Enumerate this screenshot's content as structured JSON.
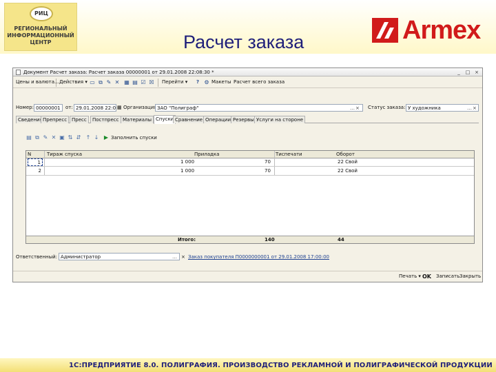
{
  "slide": {
    "title": "Расчет заказа",
    "logo_emblem": "РИЦ",
    "logo_text": "РЕГИОНАЛЬНЫЙ\nИНФОРМАЦИОННЫЙ\nЦЕНТР",
    "brand": "Armex",
    "footer": "1С:ПРЕДПРИЯТИЕ 8.0. ПОЛИГРАФИЯ. ПРОИЗВОДСТВО РЕКЛАМНОЙ И ПОЛИГРАФИЧЕСКОЙ ПРОДУКЦИИ",
    "colors": {
      "title": "#1f1f7a",
      "brand": "#d11b1b",
      "band": "#f3df75"
    }
  },
  "window": {
    "title": "Документ Расчет заказа: Расчет заказа 00000001 от 29.01.2008 22:08:30 *",
    "controls": [
      "_",
      "□",
      "×"
    ]
  },
  "toolbar": {
    "prices": "Цены и валюта...",
    "actions": "Действия ▾",
    "goto": "Перейти ▾",
    "help": "?",
    "layouts": "Макеты",
    "calc_all": "Расчет всего заказа"
  },
  "header": {
    "number_label": "Номер:",
    "number_value": "00000001",
    "date_label": "от:",
    "date_value": "29.01.2008 22:08:30",
    "org_label": "Организация:",
    "org_value": "ЗАО \"Полиграф\"",
    "status_label": "Статус заказа:",
    "status_value": "У художника"
  },
  "tabs": [
    "Сведения",
    "Препресс",
    "Пресс",
    "Постпресс",
    "Материалы",
    "Спуски",
    "Сравнение",
    "Операции",
    "Резервы",
    "Услуги на стороне"
  ],
  "active_tab": "Спуски",
  "grid_toolbar": {
    "fill_label": "Заполнить спуски"
  },
  "grid": {
    "columns": [
      "N",
      "Тираж спуска",
      "Приладка",
      "Тиспечати",
      "Оборот"
    ],
    "rows": [
      {
        "n": "1",
        "run": "",
        "makeready": "1 000",
        "imprints": "70",
        "turn": "22 Свой"
      },
      {
        "n": "2",
        "run": "",
        "makeready": "1 000",
        "imprints": "70",
        "turn": "22 Свой"
      }
    ],
    "total_label": "Итого:",
    "total_imprints": "140",
    "total_turn": "44"
  },
  "bottom": {
    "responsible_label": "Ответственный:",
    "responsible_value": "Администратор",
    "order_link": "Заказ покупателя П0000000001 от 29.01.2008 17:00:00"
  },
  "statusbar": {
    "print": "Печать ▾",
    "ok": "OK",
    "save": "Записать",
    "close": "Закрыть"
  }
}
